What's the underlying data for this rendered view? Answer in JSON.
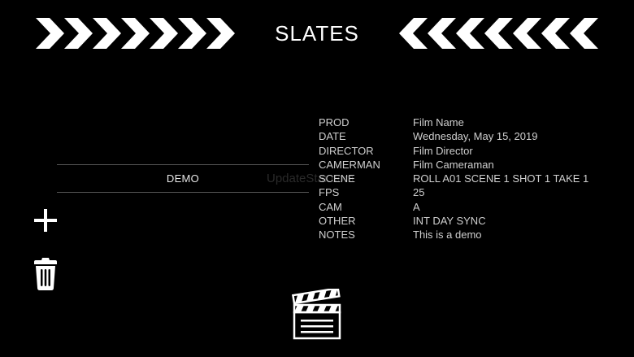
{
  "header": {
    "title": "SLATES"
  },
  "slates": [
    {
      "name": "DEMO"
    }
  ],
  "watermark": "UpdateStar.com",
  "details": [
    {
      "label": "PROD",
      "value": "Film Name"
    },
    {
      "label": "DATE",
      "value": "Wednesday, May 15, 2019"
    },
    {
      "label": "DIRECTOR",
      "value": "Film Director"
    },
    {
      "label": "CAMERMAN",
      "value": "Film Cameraman"
    },
    {
      "label": "SCENE",
      "value": "ROLL A01 SCENE 1 SHOT 1 TAKE 1"
    },
    {
      "label": "FPS",
      "value": "25"
    },
    {
      "label": "CAM",
      "value": "A"
    },
    {
      "label": "OTHER",
      "value": "INT DAY SYNC"
    },
    {
      "label": "NOTES",
      "value": "This is a demo"
    }
  ],
  "icons": {
    "left_chevrons": "chevron-right-icon",
    "right_chevrons": "chevron-left-icon",
    "add": "plus-icon",
    "delete": "trash-icon",
    "open_slate": "clapperboard-icon"
  },
  "colors": {
    "background": "#000000",
    "foreground": "#ffffff",
    "divider": "#555555"
  }
}
